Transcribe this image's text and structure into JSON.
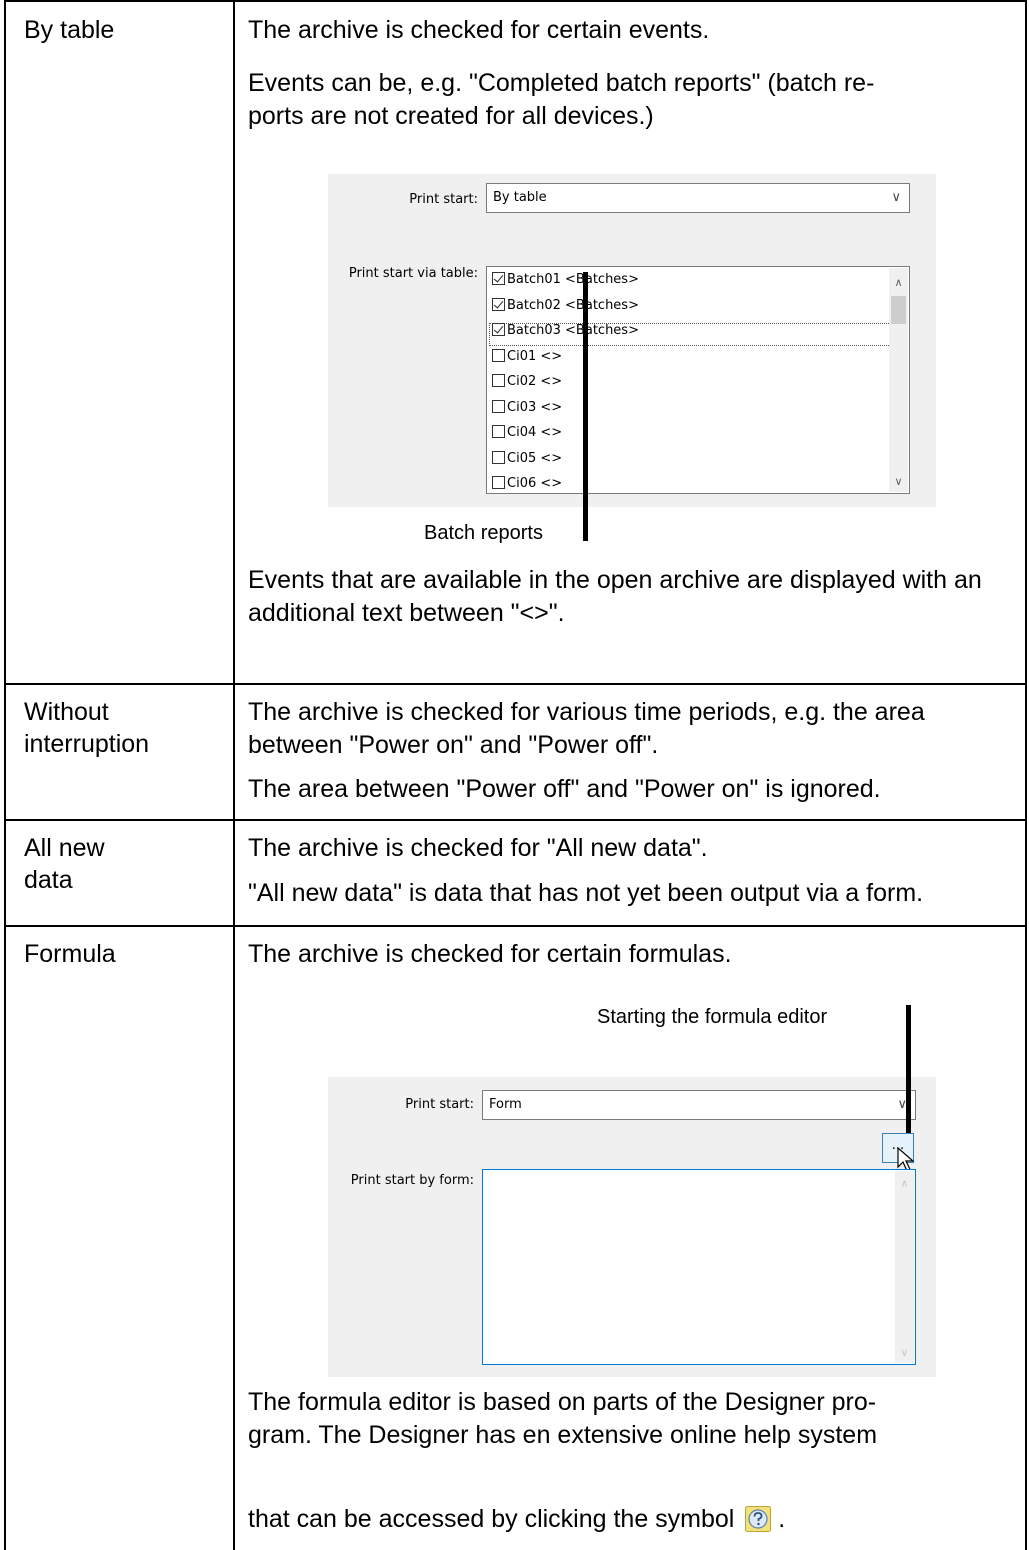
{
  "rows": [
    {
      "label": "By table",
      "paragraphs": [
        "The archive is checked for certain events.",
        "Events can be, e.g. \"Completed batch reports\" (batch re-\nports are not created for all devices.)",
        "Events that are available in the open archive are displayed with an additional text between \"<>\"."
      ]
    },
    {
      "label": "Without\ninterruption",
      "paragraphs": [
        "The archive is checked for various time periods, e.g. the area between \"Power on\" and \"Power off\".",
        "The area between \"Power off\" and \"Power on\" is ignored."
      ]
    },
    {
      "label": "All new\ndata",
      "paragraphs": [
        "The archive is checked for \"All new data\".",
        "\"All new data\" is data that has not yet been output via a form."
      ]
    },
    {
      "label": "Formula",
      "paragraphs": [
        "The archive is checked for certain formulas.",
        "The formula editor is based on parts of the Designer pro-\ngram. The Designer has en extensive online help system",
        "that can be accessed by clicking the symbol",
        "."
      ]
    }
  ],
  "table_shot": {
    "print_start_label": "Print start:",
    "print_start_value": "By table",
    "via_table_label": "Print start via table:",
    "items": [
      {
        "text": "Batch01 <Batches>",
        "checked": true
      },
      {
        "text": "Batch02 <Batches>",
        "checked": true
      },
      {
        "text": "Batch03 <Batches>",
        "checked": true
      },
      {
        "text": "Ci01 <>",
        "checked": false
      },
      {
        "text": "Ci02 <>",
        "checked": false
      },
      {
        "text": "Ci03 <>",
        "checked": false
      },
      {
        "text": "Ci04 <>",
        "checked": false
      },
      {
        "text": "Ci05 <>",
        "checked": false
      },
      {
        "text": "Ci06 <>",
        "checked": false
      }
    ],
    "callout": "Batch reports"
  },
  "form_shot": {
    "callout": "Starting the formula editor",
    "print_start_label": "Print start:",
    "print_start_value": "Form",
    "by_form_label": "Print start by form:",
    "ellipsis_button": "...",
    "help_icon": "help-question-icon"
  }
}
